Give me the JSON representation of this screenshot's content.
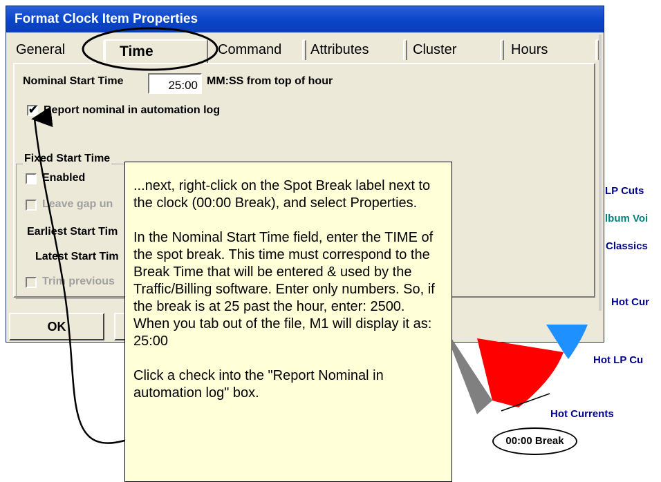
{
  "dialog": {
    "title": "Format Clock Item Properties",
    "tabs": [
      "General",
      "Time",
      "Command",
      "Attributes",
      "Cluster",
      "Hours"
    ],
    "active_tab": "Time"
  },
  "time_tab": {
    "nominal_start_label": "Nominal Start Time",
    "nominal_start_value": "25:00",
    "nominal_start_suffix": "MM:SS from top of hour",
    "report_checkbox_label": "Report nominal in automation log",
    "report_checked": true,
    "fixed_group_title": "Fixed Start Time",
    "enabled_label": "Enabled",
    "leave_gap_label": "Leave gap un",
    "earliest_label": "Earliest Start Tim",
    "latest_label": "Latest Start Tim",
    "trim_label": "Trim previous"
  },
  "buttons": {
    "ok_label": "OK"
  },
  "callout": {
    "para1": "...next, right-click on the Spot Break label next to the clock  (00:00 Break), and select Properties.",
    "para2": "In the Nominal Start Time field, enter the TIME of the spot break.  This time must correspond to the Break Time that will be entered & used by the Traffic/Billing software.  Enter only numbers.  So, if the break is at 25 past the hour, enter:  2500. When you tab out  of the file, M1 will display it as:  25:00",
    "para3": "Click a check into the \"Report Nominal in automation log\" box."
  },
  "clock": {
    "labels": [
      "LP Cuts",
      "lbum Voi",
      "Classics",
      "Hot Cur",
      "Hot LP Cu",
      "Hot Currents"
    ],
    "break_label": "00:00 Break",
    "colors": {
      "navy": "#00008b",
      "teal": "#008080",
      "red": "#ff0000",
      "blue": "#1e90ff",
      "gray": "#808080"
    }
  }
}
